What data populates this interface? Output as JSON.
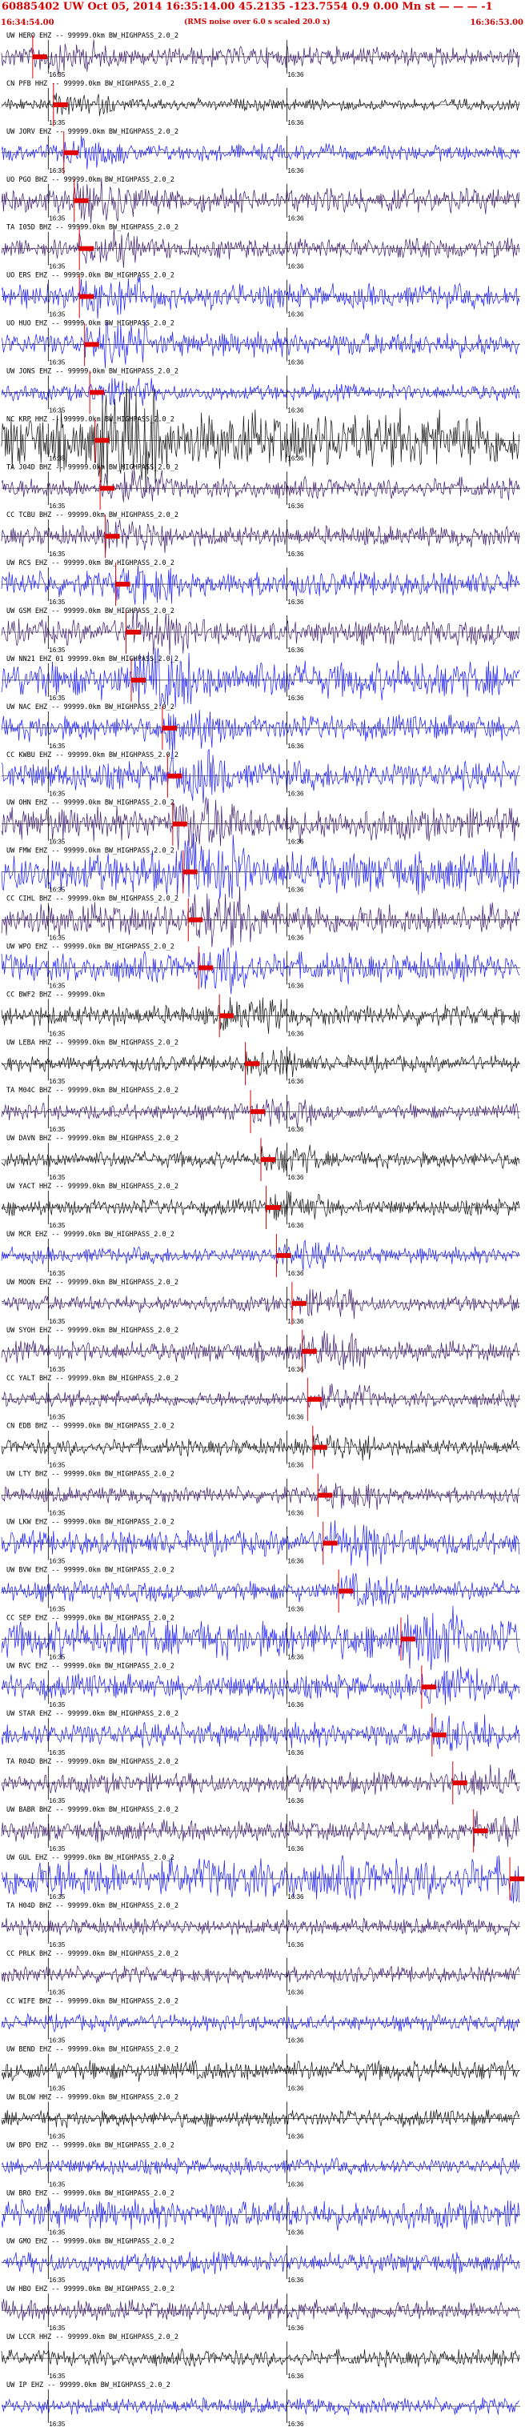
{
  "header": {
    "title": "60885402 UW Oct 05, 2014 16:35:14.00   45.2135 -123.7554  0.9 0.00 Mn st — — — -1",
    "start_time": "16:34:54.00",
    "end_time": "16:36:53.00",
    "note": "(RMS noise over 6.0 s scaled 20.0 x)"
  },
  "colors": {
    "blue": "#1a1aff",
    "purple": "#3b1a6e",
    "black": "#111111",
    "pick": "#e00000",
    "tick": "#000000"
  },
  "chart_data": {
    "type": "seismogram",
    "x_start": "16:34:54.00",
    "x_end": "16:36:53.00",
    "tick_labels": [
      "16:35",
      "16:36"
    ],
    "rows": [
      {
        "label": "UW HERO EHZ -- 99999.0km BW_HIGHPASS_2.0_2",
        "color": "purple",
        "amp": 0.25,
        "pick": 0.06
      },
      {
        "label": "CN PFB HHZ -- 99999.0km BW_HIGHPASS_2.0_2",
        "color": "black",
        "amp": 0.15,
        "pick": 0.1
      },
      {
        "label": "UW JORV EHZ -- 99999.0km BW_HIGHPASS_2.0_2",
        "color": "blue",
        "amp": 0.2,
        "pick": 0.12
      },
      {
        "label": "UO PGO BHZ -- 99999.0km BW_HIGHPASS_2.0_2",
        "color": "purple",
        "amp": 0.3,
        "pick": 0.14
      },
      {
        "label": "TA I05D BHZ -- 99999.0km BW_HIGHPASS_2.0_2",
        "color": "purple",
        "amp": 0.25,
        "pick": 0.15
      },
      {
        "label": "UO ERS EHZ -- 99999.0km BW_HIGHPASS_2.0_2",
        "color": "blue",
        "amp": 0.3,
        "pick": 0.15
      },
      {
        "label": "UO HUO EHZ -- 99999.0km BW_HIGHPASS_2.0_2",
        "color": "blue",
        "amp": 0.3,
        "pick": 0.16
      },
      {
        "label": "UW JONS EHZ -- 99999.0km BW_HIGHPASS_2.0_2",
        "color": "blue",
        "amp": 0.2,
        "pick": 0.17
      },
      {
        "label": "NC KRP HHZ -- 99999.0km BW_HIGHPASS_2.0_2",
        "color": "black",
        "amp": 0.7,
        "pick": 0.18
      },
      {
        "label": "TA J04D BHZ -- 99999.0km BW_HIGHPASS_2.0_2",
        "color": "purple",
        "amp": 0.25,
        "pick": 0.19
      },
      {
        "label": "CC TCBU BHZ -- 99999.0km BW_HIGHPASS_2.0_2",
        "color": "purple",
        "amp": 0.25,
        "pick": 0.2
      },
      {
        "label": "UW RCS EHZ -- 99999.0km BW_HIGHPASS_2.0_2",
        "color": "blue",
        "amp": 0.3,
        "pick": 0.22
      },
      {
        "label": "UW GSM EHZ -- 99999.0km BW_HIGHPASS_2.0_2",
        "color": "purple",
        "amp": 0.3,
        "pick": 0.24
      },
      {
        "label": "UW NN21 EHZ 01 99999.0km BW_HIGHPASS_2.0_2",
        "color": "blue",
        "amp": 0.45,
        "pick": 0.25
      },
      {
        "label": "UW NAC EHZ -- 99999.0km BW_HIGHPASS_2.0_2",
        "color": "blue",
        "amp": 0.3,
        "pick": 0.31
      },
      {
        "label": "CC KWBU EHZ -- 99999.0km BW_HIGHPASS_2.0_2",
        "color": "blue",
        "amp": 0.35,
        "pick": 0.32
      },
      {
        "label": "UW OHN EHZ -- 99999.0km BW_HIGHPASS_2.0_2",
        "color": "purple",
        "amp": 0.4,
        "pick": 0.33
      },
      {
        "label": "UW FMW EHZ -- 99999.0km BW_HIGHPASS_2.0_2",
        "color": "blue",
        "amp": 0.5,
        "pick": 0.35
      },
      {
        "label": "CC CIHL BHZ -- 99999.0km BW_HIGHPASS_2.0_2",
        "color": "purple",
        "amp": 0.4,
        "pick": 0.36
      },
      {
        "label": "UW WPO EHZ -- 99999.0km BW_HIGHPASS_2.0_2",
        "color": "blue",
        "amp": 0.35,
        "pick": 0.38
      },
      {
        "label": "CC BWF2 BHZ -- 99999.0km",
        "color": "black",
        "amp": 0.25,
        "pick": 0.42
      },
      {
        "label": "UW LEBA HHZ -- 99999.0km BW_HIGHPASS_2.0_2",
        "color": "black",
        "amp": 0.2,
        "pick": 0.47
      },
      {
        "label": "TA M04C BHZ -- 99999.0km BW_HIGHPASS_2.0_2",
        "color": "purple",
        "amp": 0.2,
        "pick": 0.48
      },
      {
        "label": "UW DAVN BHZ -- 99999.0km BW_HIGHPASS_2.0_2",
        "color": "black",
        "amp": 0.2,
        "pick": 0.5
      },
      {
        "label": "UW YACT HHZ -- 99999.0km BW_HIGHPASS_2.0_2",
        "color": "black",
        "amp": 0.2,
        "pick": 0.51
      },
      {
        "label": "UW MCR EHZ -- 99999.0km BW_HIGHPASS_2.0_2",
        "color": "blue",
        "amp": 0.2,
        "pick": 0.53
      },
      {
        "label": "UW MOON EHZ -- 99999.0km BW_HIGHPASS_2.0_2",
        "color": "purple",
        "amp": 0.2,
        "pick": 0.56
      },
      {
        "label": "UW SYOH EHZ -- 99999.0km BW_HIGHPASS_2.0_2",
        "color": "purple",
        "amp": 0.25,
        "pick": 0.58
      },
      {
        "label": "CC YALT BHZ -- 99999.0km BW_HIGHPASS_2.0_2",
        "color": "purple",
        "amp": 0.2,
        "pick": 0.59
      },
      {
        "label": "CN EDB BHZ -- 99999.0km BW_HIGHPASS_2.0_2",
        "color": "black",
        "amp": 0.2,
        "pick": 0.6
      },
      {
        "label": "UW LTY BHZ -- 99999.0km BW_HIGHPASS_2.0_2",
        "color": "purple",
        "amp": 0.2,
        "pick": 0.61
      },
      {
        "label": "UW LKW EHZ -- 99999.0km BW_HIGHPASS_2.0_2",
        "color": "blue",
        "amp": 0.3,
        "pick": 0.62
      },
      {
        "label": "UW BVW EHZ -- 99999.0km BW_HIGHPASS_2.0_2",
        "color": "blue",
        "amp": 0.25,
        "pick": 0.65
      },
      {
        "label": "CC SEP EHZ -- 99999.0km BW_HIGHPASS_2.0_2",
        "color": "blue",
        "amp": 0.45,
        "pick": 0.77
      },
      {
        "label": "UW RVC EHZ -- 99999.0km BW_HIGHPASS_2.0_2",
        "color": "blue",
        "amp": 0.3,
        "pick": 0.81
      },
      {
        "label": "UW STAR EHZ -- 99999.0km BW_HIGHPASS_2.0_2",
        "color": "blue",
        "amp": 0.3,
        "pick": 0.83
      },
      {
        "label": "TA R04D BHZ -- 99999.0km BW_HIGHPASS_2.0_2",
        "color": "purple",
        "amp": 0.25,
        "pick": 0.87
      },
      {
        "label": "UW BABR BHZ -- 99999.0km BW_HIGHPASS_2.0_2",
        "color": "purple",
        "amp": 0.25,
        "pick": 0.91
      },
      {
        "label": "UW GUL EHZ -- 99999.0km BW_HIGHPASS_2.0_2",
        "color": "blue",
        "amp": 0.5,
        "pick": 0.98
      },
      {
        "label": "TA H04D BHZ -- 99999.0km BW_HIGHPASS_2.0_2",
        "color": "purple",
        "amp": 0.2,
        "pick": -1
      },
      {
        "label": "CC PRLK BHZ -- 99999.0km BW_HIGHPASS_2.0_2",
        "color": "purple",
        "amp": 0.2,
        "pick": -1
      },
      {
        "label": "CC WIFE BHZ -- 99999.0km BW_HIGHPASS_2.0_2",
        "color": "blue",
        "amp": 0.2,
        "pick": -1
      },
      {
        "label": "UW BEND EHZ -- 99999.0km BW_HIGHPASS_2.0_2",
        "color": "black",
        "amp": 0.25,
        "pick": -1
      },
      {
        "label": "UW BLOW HHZ -- 99999.0km BW_HIGHPASS_2.0_2",
        "color": "black",
        "amp": 0.2,
        "pick": -1
      },
      {
        "label": "UW BPO EHZ -- 99999.0km BW_HIGHPASS_2.0_2",
        "color": "blue",
        "amp": 0.2,
        "pick": -1
      },
      {
        "label": "UW BRO EHZ -- 99999.0km BW_HIGHPASS_2.0_2",
        "color": "blue",
        "amp": 0.35,
        "pick": -1
      },
      {
        "label": "UW GMO EHZ -- 99999.0km BW_HIGHPASS_2.0_2",
        "color": "blue",
        "amp": 0.25,
        "pick": -1
      },
      {
        "label": "UW HBO EHZ -- 99999.0km BW_HIGHPASS_2.0_2",
        "color": "purple",
        "amp": 0.25,
        "pick": -1
      },
      {
        "label": "UW LCCR HHZ -- 99999.0km BW_HIGHPASS_2.0_2",
        "color": "black",
        "amp": 0.2,
        "pick": -1
      },
      {
        "label": "UW IP EHZ -- 99999.0km BW_HIGHPASS_2.0_2",
        "color": "blue",
        "amp": 0.2,
        "pick": -1
      }
    ]
  }
}
